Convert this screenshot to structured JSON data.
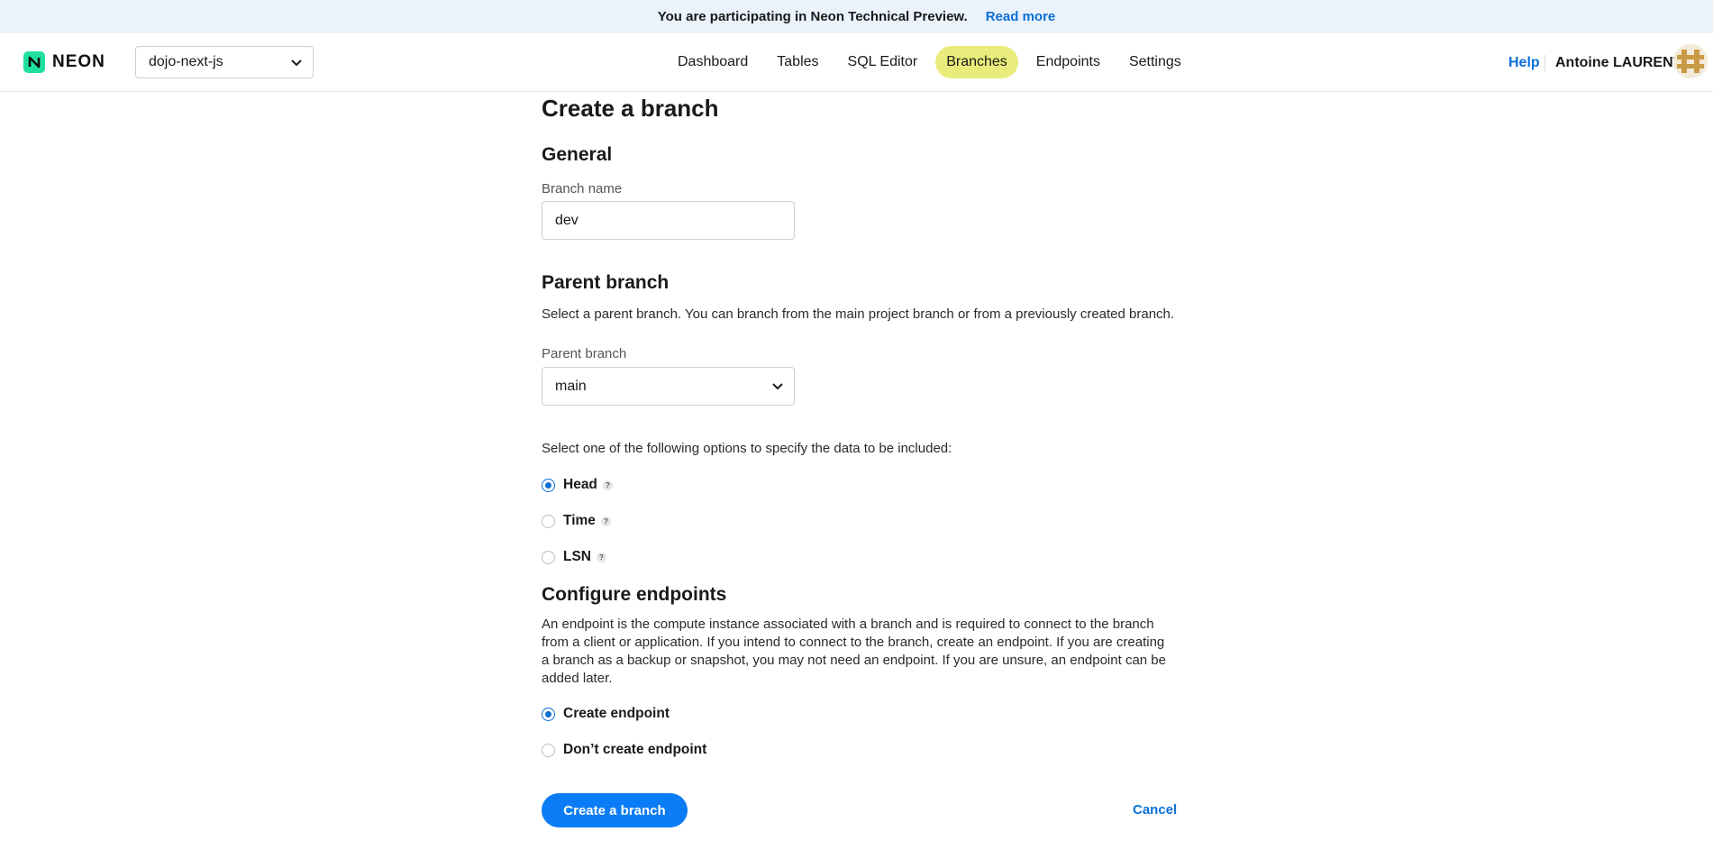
{
  "banner": {
    "message": "You are participating in Neon Technical Preview.",
    "link": "Read more"
  },
  "header": {
    "logo_text": "NEON",
    "project": "dojo-next-js",
    "nav": [
      "Dashboard",
      "Tables",
      "SQL Editor",
      "Branches",
      "Endpoints",
      "Settings"
    ],
    "active_nav": "Branches",
    "help": "Help",
    "user": "Antoine LAURENT"
  },
  "page": {
    "title": "Create a branch",
    "general": {
      "title": "General",
      "branch_name_label": "Branch name",
      "branch_name_value": "dev"
    },
    "parent": {
      "title": "Parent branch",
      "description": "Select a parent branch. You can branch from the main project branch or from a previously created branch.",
      "label": "Parent branch",
      "selected": "main",
      "data_prompt": "Select one of the following options to specify the data to be included:",
      "options": [
        "Head",
        "Time",
        "LSN"
      ],
      "selected_option": "Head",
      "help_glyph": "?"
    },
    "endpoints": {
      "title": "Configure endpoints",
      "description": "An endpoint is the compute instance associated with a branch and is required to connect to the branch from a client or application. If you intend to connect to the branch, create an endpoint. If you are creating a branch as a backup or snapshot, you may not need an endpoint. If you are unsure, an endpoint can be added later.",
      "options": [
        "Create endpoint",
        "Don’t create endpoint"
      ],
      "selected_option": "Create endpoint"
    },
    "actions": {
      "submit": "Create a branch",
      "cancel": "Cancel"
    }
  },
  "colors": {
    "accent": "#0b7cf5",
    "active_nav_bg": "#e9ec7a",
    "banner_bg": "#eaf2fb",
    "logo": "#1fe0a0"
  }
}
